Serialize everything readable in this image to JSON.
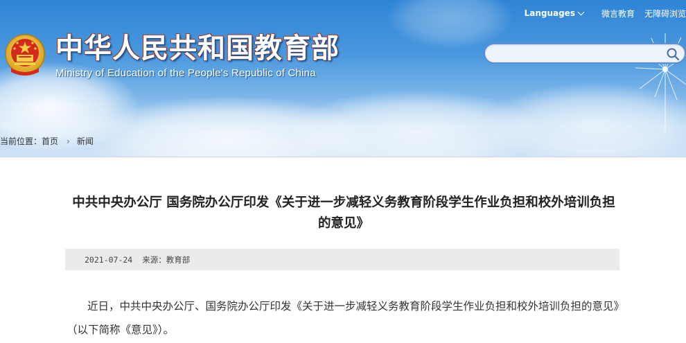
{
  "top_links": {
    "languages": "Languages",
    "weiyan": "微言教育",
    "accessibility": "无障碍浏览"
  },
  "site": {
    "title": "中华人民共和国教育部",
    "subtitle": "Ministry of Education of the People's Republic of China"
  },
  "search": {
    "value": "",
    "placeholder": ""
  },
  "breadcrumb": {
    "prefix": "当前位置：",
    "home": "首页",
    "current": "新闻"
  },
  "article": {
    "title": "中共中央办公厅 国务院办公厅印发《关于进一步减轻义务教育阶段学生作业负担和校外培训负担的意见》",
    "date": "2021-07-24",
    "source": "来源：教育部",
    "paragraph": "近日，中共中央办公厅、国务院办公厅印发《关于进一步减轻义务教育阶段学生作业负担和校外培训负担的意见》（以下简称《意见》）。"
  },
  "colors": {
    "header_top": "#2f84d6",
    "header_bottom": "#cfe2f6",
    "emblem_red": "#d42a1e",
    "emblem_gold": "#f2c230",
    "meta_bg": "#ebebeb"
  },
  "icons": {
    "emblem": "national-emblem-icon",
    "search": "search-icon",
    "languages": "chevron-down-icon",
    "breadcrumb": "chevron-right-icon"
  }
}
